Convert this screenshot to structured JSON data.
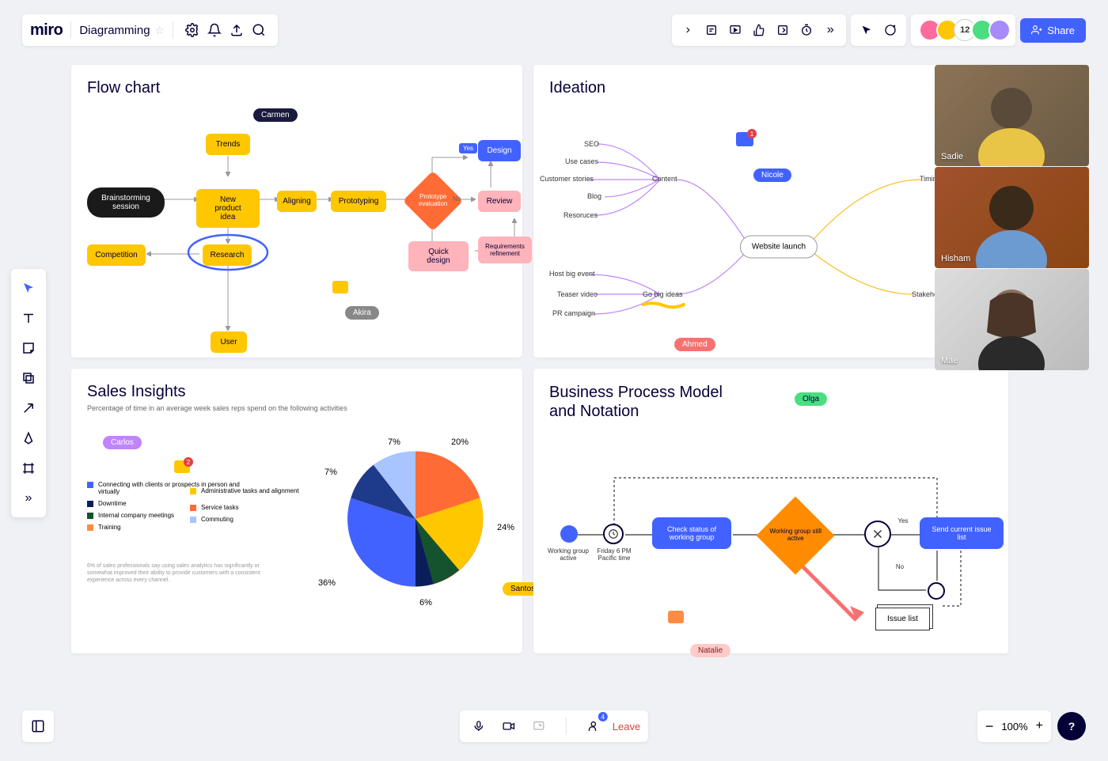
{
  "app": {
    "logo": "miro",
    "board_name": "Diagramming",
    "share_label": "Share",
    "avatar_count": "12"
  },
  "frames": {
    "flowchart": {
      "title": "Flow chart",
      "nodes": {
        "brainstorm": "Brainstorming session",
        "trends": "Trends",
        "new_product": "New product idea",
        "aligning": "Aligning",
        "prototyping": "Prototyping",
        "proto_eval": "Prototype evaluation",
        "design": "Design",
        "review": "Review",
        "quick_design": "Quick design",
        "req_refine": "Requirements refinement",
        "competition": "Competition",
        "research": "Research",
        "user": "User",
        "yes": "Yes",
        "no": "No"
      }
    },
    "ideation": {
      "title": "Ideation",
      "root": "Website launch",
      "branches": {
        "content": "Content",
        "content_items": [
          "SEO",
          "Use cases",
          "Customer stories",
          "Blog",
          "Resoruces"
        ],
        "gobig": "Go big ideas",
        "gobig_items": [
          "Host big event",
          "Teaser video",
          "PR campaign"
        ],
        "timing": "Timing",
        "stakeholders": "Stakeholders"
      }
    },
    "sales": {
      "title": "Sales Insights",
      "subtitle": "Percentage of time in an average week sales reps spend on the following activities",
      "footnote": "6% of sales professionals say using sales analytics has significantly or somewhat improved their ability to provide customers with a consistent experience across every channel."
    },
    "bpmn": {
      "title": "Business Process Model and Notation",
      "nodes": {
        "start": "Working group active",
        "timer": "Friday 6 PM Pacific time",
        "check": "Check status of working group",
        "decide": "Working group still active",
        "send": "Send current issue list",
        "issue": "Issue list",
        "yes": "Yes",
        "no": "No"
      }
    }
  },
  "cursors": {
    "carmen": "Carmen",
    "akira": "Akira",
    "nicole": "Nicole",
    "ahmed": "Ahmed",
    "carlos": "Carlos",
    "santosh": "Santosh",
    "olga": "Olga",
    "natalie": "Natalie"
  },
  "comment_badges": {
    "nicole": "1",
    "carlos": "2"
  },
  "video": {
    "names": [
      "Sadie",
      "Hisham",
      "Mae"
    ]
  },
  "bottom": {
    "leave": "Leave",
    "zoom": "100%",
    "presence_badge": "4"
  },
  "chart_data": {
    "type": "pie",
    "title": "Sales Insights",
    "series": [
      {
        "name": "Connecting with clients or prospects in person and virtually",
        "value": 36,
        "color": "#4262ff"
      },
      {
        "name": "Administrative tasks and alignment",
        "value": 24,
        "color": "#ffc700"
      },
      {
        "name": "Downtime",
        "value": 6,
        "color": "#0a1e5c"
      },
      {
        "name": "Internal company meetings",
        "value": 7,
        "color": "#14532d"
      },
      {
        "name": "Training",
        "value": 7,
        "color": "#ff8c42"
      },
      {
        "name": "Service tasks",
        "value": 20,
        "color": "#ff6b35"
      },
      {
        "name": "Commuting",
        "value": 7,
        "color": "#a8c5ff"
      }
    ],
    "labels": [
      "20%",
      "24%",
      "6%",
      "36%",
      "7%",
      "7%"
    ]
  }
}
